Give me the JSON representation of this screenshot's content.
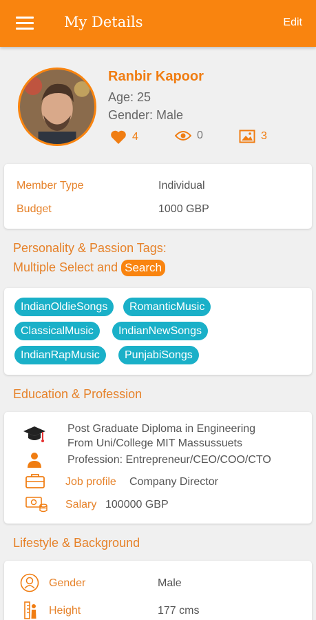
{
  "appbar": {
    "title": "My Details",
    "edit_label": "Edit"
  },
  "profile": {
    "name": "Ranbir Kapoor",
    "age": "Age: 25",
    "gender": "Gender: Male",
    "likes": "4",
    "views": "0",
    "photos": "3"
  },
  "membership": {
    "rows": [
      {
        "label": "Member Type",
        "value": "Individual"
      },
      {
        "label": "Budget",
        "value": "1000 GBP"
      }
    ]
  },
  "tags_section": {
    "title_line1": "Personality & Passion Tags:",
    "title_line2": "Multiple Select and",
    "search_label": "Search",
    "tags": [
      "IndianOldieSongs",
      "RomanticMusic",
      "ClassicalMusic",
      "IndianNewSongs",
      "IndianRapMusic",
      "PunjabiSongs"
    ]
  },
  "education": {
    "title": "Education & Profession",
    "degree_line1": "Post Graduate Diploma in Engineering",
    "degree_line2": "From Uni/College MIT Massussuets",
    "profession": "Profession: Entrepreneur/CEO/COO/CTO",
    "job_label": "Job profile",
    "job_value": "Company Director",
    "salary_label": "Salary",
    "salary_value": "100000 GBP"
  },
  "lifestyle": {
    "title": "Lifestyle & Background",
    "rows": [
      {
        "label": "Gender",
        "value": "Male"
      },
      {
        "label": "Height",
        "value": "177 cms"
      }
    ]
  },
  "colors": {
    "accent": "#f9840f",
    "tag": "#1ab0c8",
    "label": "#e6822a"
  }
}
